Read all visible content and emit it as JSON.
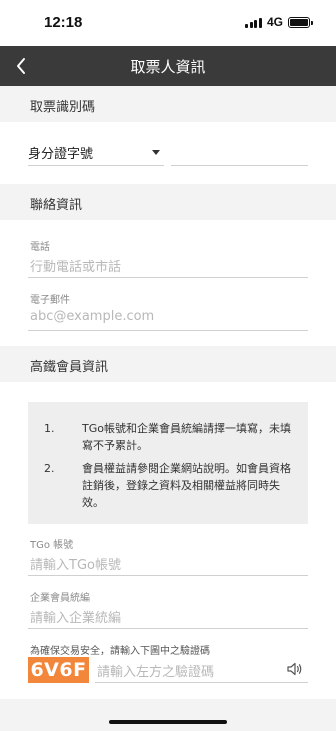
{
  "status_bar": {
    "time": "12:18",
    "network": "4G"
  },
  "nav": {
    "title": "取票人資訊",
    "back_icon": "chevron-left-icon"
  },
  "sections": {
    "ticket_id": {
      "title": "取票識別碼",
      "id_type_selected": "身分證字號",
      "id_number_value": ""
    },
    "contact": {
      "title": "聯絡資訊",
      "phone": {
        "label": "電話",
        "placeholder": "行動電話或市話"
      },
      "email": {
        "label": "電子郵件",
        "placeholder": "abc@example.com"
      }
    },
    "member": {
      "title": "高鐵會員資訊",
      "notices": [
        {
          "num": "1.",
          "text": "TGo帳號和企業會員統編請擇一填寫，未填寫不予累計。"
        },
        {
          "num": "2.",
          "text": "會員權益請參閱企業網站說明。如會員資格註銷後，登錄之資料及相關權益將同時失效。"
        }
      ],
      "tgo": {
        "label": "TGo 帳號",
        "placeholder": "請輸入TGo帳號"
      },
      "corp": {
        "label": "企業會員統編",
        "placeholder": "請輸入企業統編"
      },
      "captcha": {
        "label": "為確保交易安全，請輸入下圖中之驗證碼",
        "code": "6V6F",
        "placeholder": "請輸入左方之驗證碼",
        "audio_icon": "speaker-icon"
      }
    }
  },
  "colors": {
    "nav_bg": "#3a3a3a",
    "section_bg": "#f3f3f3",
    "captcha_bg": "#f2873b",
    "placeholder": "#b8b8b8"
  }
}
